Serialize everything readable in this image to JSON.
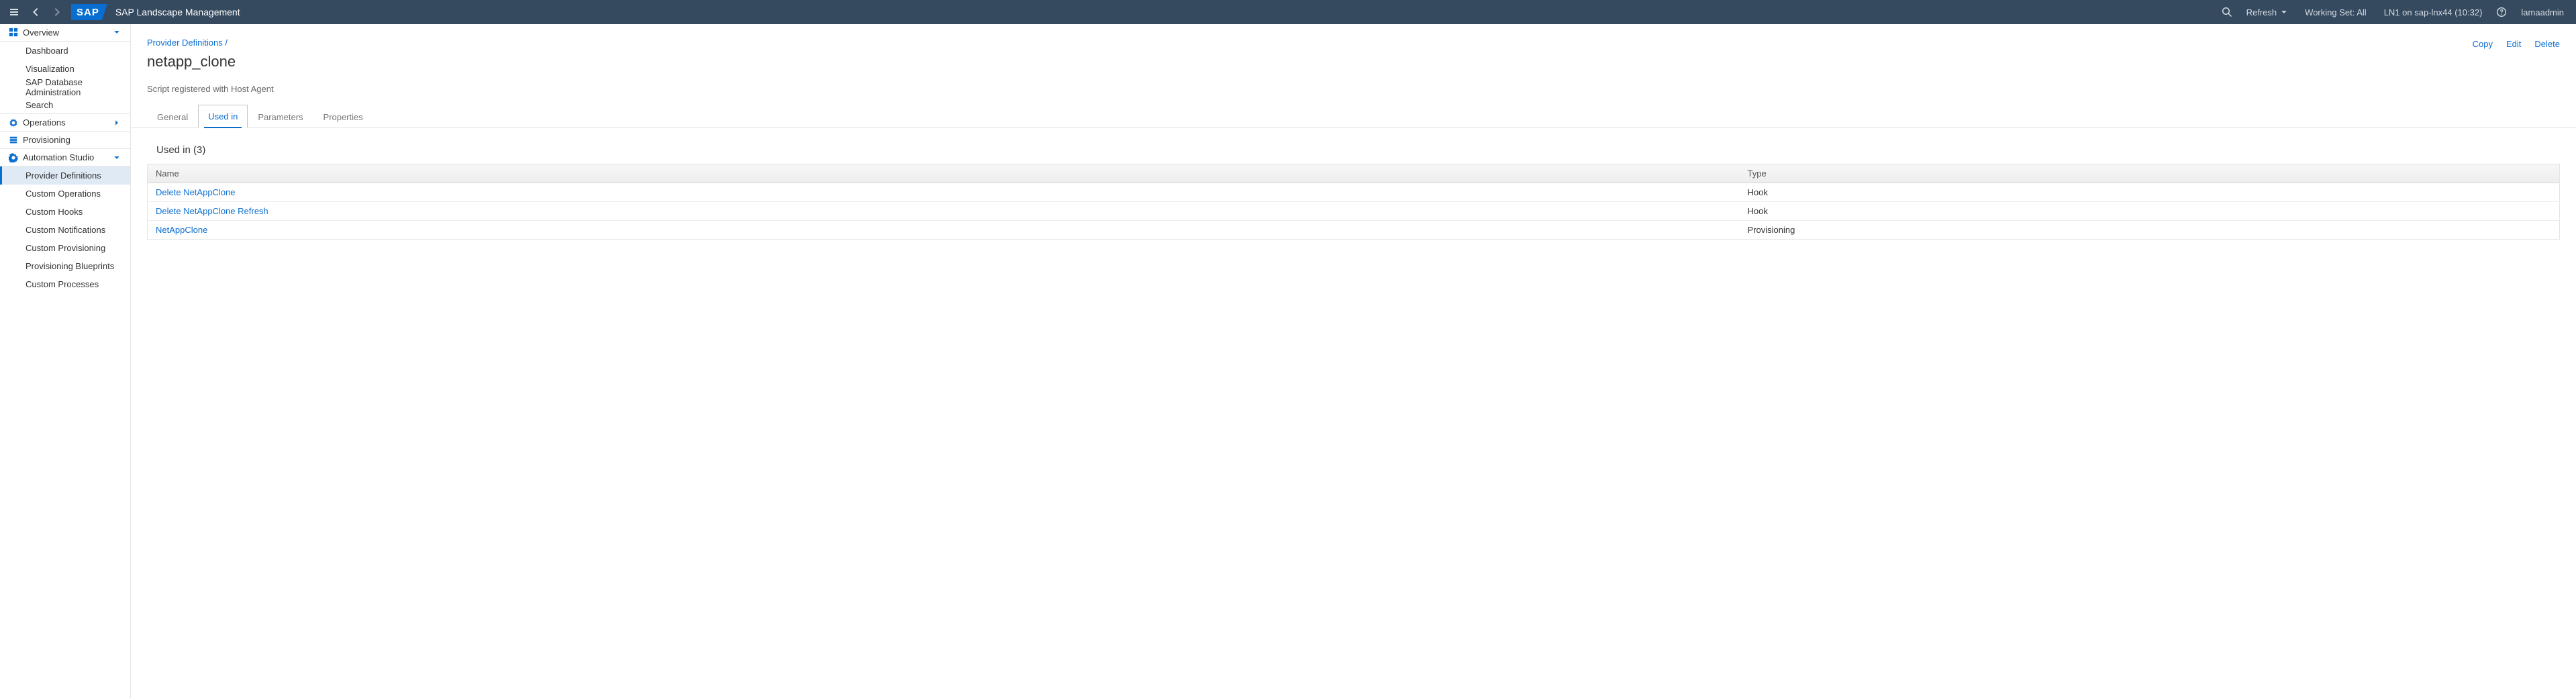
{
  "app_title": "SAP Landscape Management",
  "logo_text": "SAP",
  "header": {
    "refresh": "Refresh",
    "working_set": "Working Set: All",
    "system_info": "LN1 on sap-lnx44 (10:32)",
    "user": "lamaadmin"
  },
  "sidebar": {
    "overview": {
      "label": "Overview"
    },
    "overview_children": {
      "dashboard": "Dashboard",
      "visualization": "Visualization",
      "dbadmin": "SAP Database Administration",
      "search": "Search"
    },
    "operations": {
      "label": "Operations"
    },
    "provisioning": {
      "label": "Provisioning"
    },
    "automation": {
      "label": "Automation Studio"
    },
    "automation_children": {
      "provider_defs": "Provider Definitions",
      "custom_ops": "Custom Operations",
      "custom_hooks": "Custom Hooks",
      "custom_notif": "Custom Notifications",
      "custom_prov": "Custom Provisioning",
      "prov_blueprints": "Provisioning Blueprints",
      "custom_proc": "Custom Processes"
    }
  },
  "breadcrumb": {
    "parent": "Provider Definitions",
    "sep": "/"
  },
  "page": {
    "title": "netapp_clone",
    "subtitle": "Script registered with Host Agent"
  },
  "actions": {
    "copy": "Copy",
    "edit": "Edit",
    "delete": "Delete"
  },
  "tabs": {
    "general": "General",
    "used_in": "Used in",
    "parameters": "Parameters",
    "properties": "Properties"
  },
  "used_in_section": {
    "heading": "Used in (3)",
    "columns": {
      "name": "Name",
      "type": "Type"
    },
    "rows": [
      {
        "name": "Delete NetAppClone",
        "type": "Hook"
      },
      {
        "name": "Delete NetAppClone Refresh",
        "type": "Hook"
      },
      {
        "name": "NetAppClone",
        "type": "Provisioning"
      }
    ]
  }
}
